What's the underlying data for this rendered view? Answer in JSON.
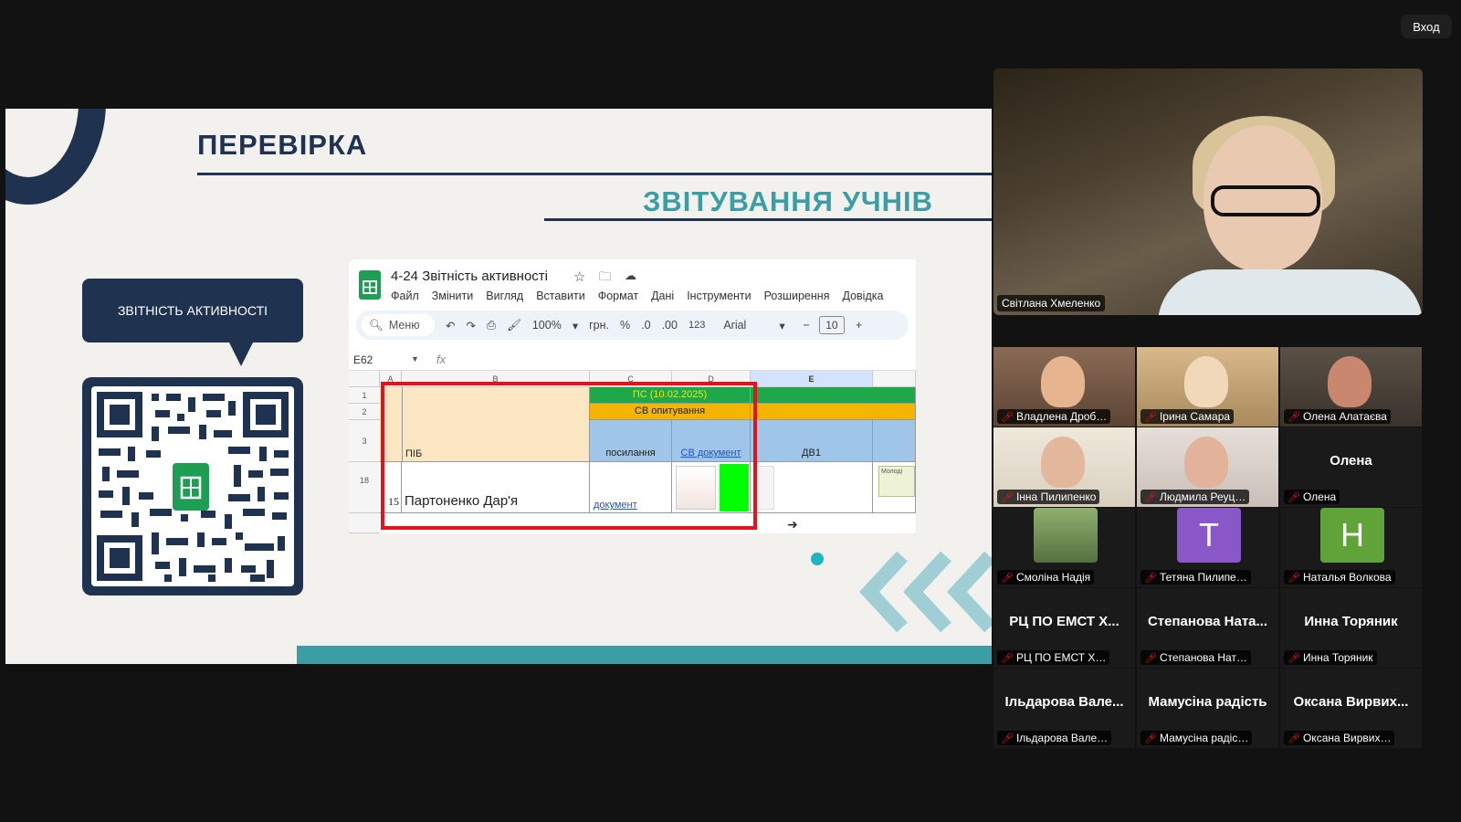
{
  "window": {
    "exit_label": "Вход"
  },
  "slide": {
    "title": "ПЕРЕВІРКА",
    "subtitle": "ЗВІТУВАННЯ УЧНІВ",
    "bubble_label": "ЗВІТНІСТЬ АКТИВНОСТІ"
  },
  "sheet": {
    "doc_title": "4-24 Звітність активності",
    "menu": [
      "Файл",
      "Змінити",
      "Вигляд",
      "Вставити",
      "Формат",
      "Дані",
      "Інструменти",
      "Розширення",
      "Довідка"
    ],
    "toolbar": {
      "search_placeholder": "Меню",
      "zoom": "100%",
      "currency": "грн.",
      "percent": "%",
      "dec_minus": ".0",
      "dec_plus": ".00",
      "format123": "123",
      "font": "Arial",
      "font_size": "10"
    },
    "namebox": "E62",
    "fx": "fx",
    "col_headers": [
      "A",
      "B",
      "C",
      "D",
      "E"
    ],
    "row_headers": [
      "1",
      "2",
      "3",
      "18"
    ],
    "cells": {
      "ps_header": "ПС (10.02.2025)",
      "sv_header": "СВ опитування",
      "pib": "ПІБ",
      "posylannia": "посилання",
      "sv_document": "СВ документ",
      "dv1": "ДВ1",
      "row_num": "15",
      "student": "Партоненко Дар'я",
      "document_link": "документ",
      "e_note": "Молоді"
    }
  },
  "video": {
    "main_speaker": "Світлана Хмеленко",
    "tiles": [
      {
        "name": "Владлена Дроб…",
        "type": "photo",
        "bg": "#8a6a55",
        "skin": "#e6b48f"
      },
      {
        "name": "Ірина Самара",
        "type": "photo",
        "bg": "#c9a878",
        "skin": "#f0d8b8"
      },
      {
        "name": "Олена Алатаєва",
        "type": "photo",
        "bg": "#4a4036",
        "skin": "#c8876e"
      },
      {
        "name": "Інна Пилипенко",
        "type": "photo",
        "bg": "#e8e2d4",
        "skin": "#e3b79c"
      },
      {
        "name": "Людмила Реуц…",
        "type": "photo",
        "bg": "#d8cfc8",
        "skin": "#e2b39a"
      },
      {
        "name": "Олена",
        "type": "text",
        "big": "Олена"
      },
      {
        "name": "Смоліна Надія",
        "type": "avatar-photo",
        "bg": "#6e8f5a"
      },
      {
        "name": "Тетяна Пилипе…",
        "type": "avatar",
        "letter": "T",
        "bg": "#8a57c9"
      },
      {
        "name": "Наталья Волкова",
        "type": "avatar",
        "letter": "H",
        "bg": "#5fa339"
      },
      {
        "name": "РЦ ПО ЕМСТ Х…",
        "type": "text",
        "big": "РЦ ПО ЕМСТ Х..."
      },
      {
        "name": "Степанова Нат…",
        "type": "text",
        "big": "Степанова Ната..."
      },
      {
        "name": "Инна Торяник",
        "type": "text",
        "big": "Инна Торяник"
      },
      {
        "name": "Ільдарова Вале…",
        "type": "text",
        "big": "Ільдарова Вале..."
      },
      {
        "name": "Мамусіна радіс…",
        "type": "text",
        "big": "Мамусіна радість"
      },
      {
        "name": "Оксана Вирвих…",
        "type": "text",
        "big": "Оксана Вирвих..."
      }
    ]
  }
}
